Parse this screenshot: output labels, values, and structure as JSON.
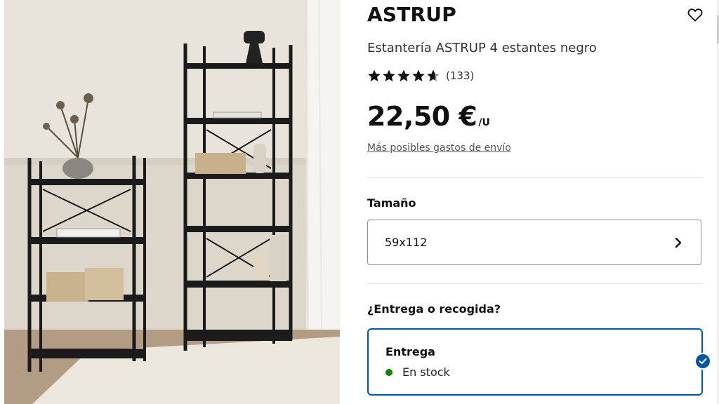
{
  "product": {
    "name": "ASTRUP",
    "description": "Estantería ASTRUP 4 estantes negro",
    "rating": 4.5,
    "rating_count": "(133)",
    "price": "22,50 €",
    "price_unit": "/U",
    "shipping_link": "Más posibles gastos de envío"
  },
  "size": {
    "label": "Tamaño",
    "selected": "59x112"
  },
  "delivery": {
    "question": "¿Entrega o recogida?",
    "option_title": "Entrega",
    "stock_status": "En stock",
    "stock_color": "#0a8a00",
    "selected": true
  },
  "icons": {
    "favorite": "heart-outline-icon",
    "rating": "star-icon",
    "chevron": "chevron-right-icon",
    "selected": "check-icon"
  },
  "colors": {
    "accent": "#0058a3",
    "text": "#111111"
  }
}
